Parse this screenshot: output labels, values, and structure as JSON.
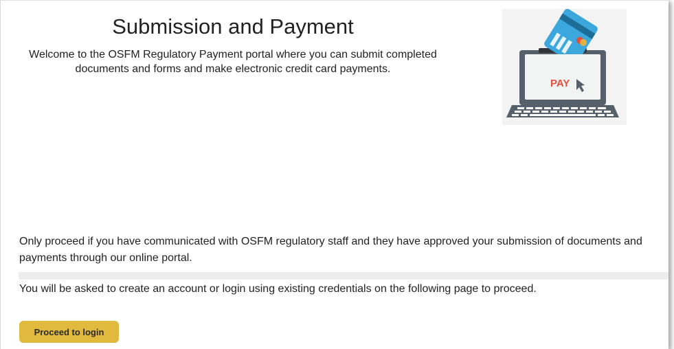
{
  "header": {
    "title": "Submission and Payment",
    "intro": "Welcome to the OSFM Regulatory Payment portal where you can submit completed documents and forms and make electronic credit card payments."
  },
  "hero": {
    "icon": "laptop-credit-card-pay-illustration",
    "screen_text": "PAY",
    "colors": {
      "card": "#3ba7dd",
      "laptop": "#55606b",
      "pay_text": "#e0503c"
    }
  },
  "body": {
    "notice": "Only proceed if you have communicated with OSFM regulatory staff and they have approved your submission of documents and payments through our online portal.",
    "info": "You will be asked to create an account or login using existing credentials on the following page to proceed."
  },
  "actions": {
    "proceed_label": "Proceed to login",
    "button_color": "#e1b93d"
  }
}
